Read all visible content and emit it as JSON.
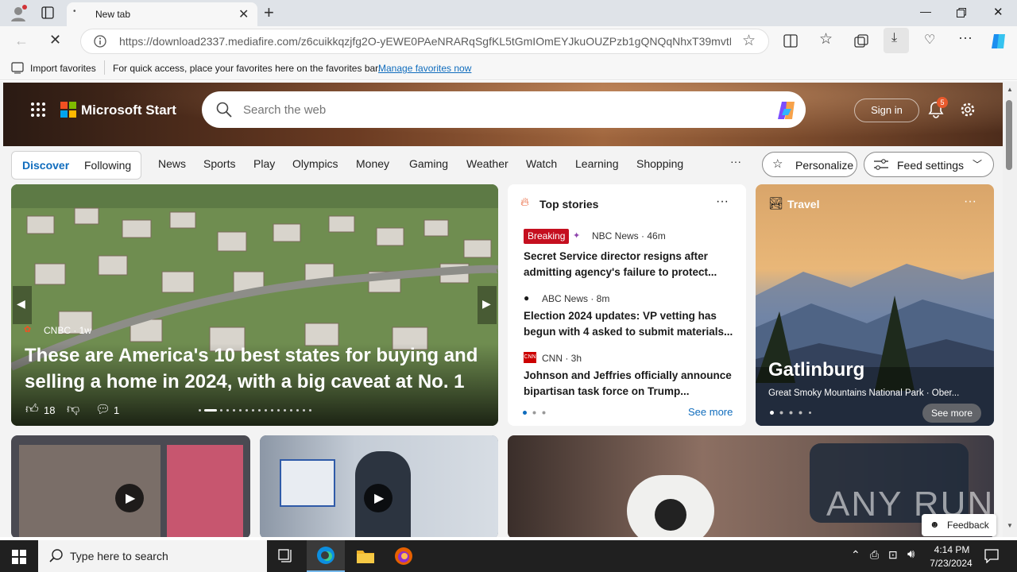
{
  "browser": {
    "tab_title": "New tab",
    "url": "https://download2337.mediafire.com/z6cuikkqzjfg2O-yEWE0PAeNRARqSgfKL5tGmIOmEYJkuOUZPzb1gQNQqNhxT39mvtD...",
    "favbar_import": "Import favorites",
    "favbar_hint": "For quick access, place your favorites here on the favorites bar.",
    "favbar_link": "Manage favorites now"
  },
  "header": {
    "brand": "Microsoft Start",
    "search_placeholder": "Search the web",
    "sign_in": "Sign in",
    "notif_count": "5"
  },
  "nav": {
    "discover": "Discover",
    "following": "Following",
    "items": [
      "News",
      "Sports",
      "Play",
      "Olympics",
      "Money",
      "Gaming",
      "Weather",
      "Watch",
      "Learning",
      "Shopping"
    ],
    "more": "···",
    "personalize": "Personalize",
    "feed_settings": "Feed settings"
  },
  "main_story": {
    "source": "CNBC · 1w",
    "headline_line1": "These are America's 10 best states for buying and",
    "headline_line2": "selling a home in 2024, with a big caveat at No. 1",
    "likes": "18",
    "comments": "1"
  },
  "top_stories": {
    "title": "Top stories",
    "items": [
      {
        "badge": "Breaking",
        "source": "NBC News · 46m",
        "line1": "Secret Service director resigns after",
        "line2": "admitting agency's failure to protect..."
      },
      {
        "badge": "",
        "source": "ABC News · 8m",
        "line1": "Election 2024 updates: VP vetting has",
        "line2": "begun with 4 asked to submit materials..."
      },
      {
        "badge": "",
        "source": "CNN · 3h",
        "line1": "Johnson and Jeffries officially announce",
        "line2": "bipartisan task force on Trump..."
      }
    ],
    "see_more": "See more"
  },
  "travel": {
    "label": "Travel",
    "place": "Gatlinburg",
    "subtitle": "Great Smoky Mountains National Park · Ober...",
    "see_more": "See more"
  },
  "feedback": "Feedback",
  "watermark": "ANY RUN",
  "taskbar": {
    "search_placeholder": "Type here to search",
    "time": "4:14 PM",
    "date": "7/23/2024"
  },
  "colors": {
    "accent": "#0f6cbd",
    "breaking": "#c50f1f",
    "taskbar": "#202020"
  }
}
